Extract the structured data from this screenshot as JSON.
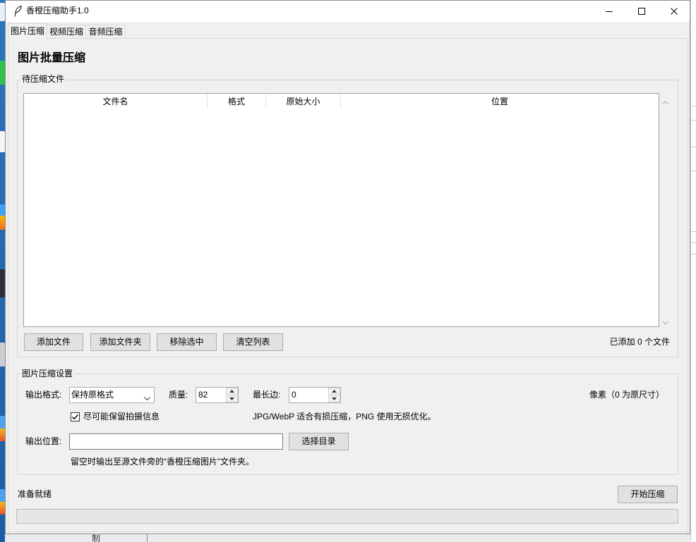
{
  "desktop": {
    "partial_label": "制"
  },
  "window": {
    "title": "香橙压缩助手1.0",
    "icon": "feather-icon",
    "controls": [
      "minimize-icon",
      "maximize-icon",
      "close-icon"
    ]
  },
  "tabs": [
    {
      "label": "图片压缩",
      "selected": true
    },
    {
      "label": "视频压缩",
      "selected": false
    },
    {
      "label": "音频压缩",
      "selected": false
    }
  ],
  "image_tab": {
    "heading": "图片批量压缩",
    "files": {
      "group_title": "待压缩文件",
      "columns": [
        "文件名",
        "格式",
        "原始大小",
        "位置"
      ],
      "rows": [],
      "scrollbar_icons": [
        "chevron-up-icon",
        "chevron-down-icon"
      ],
      "buttons": {
        "add_files": "添加文件",
        "add_folder": "添加文件夹",
        "remove_selected": "移除选中",
        "clear_list": "清空列表"
      },
      "count_text": "已添加 0 个文件"
    },
    "settings": {
      "group_title": "图片压缩设置",
      "format": {
        "label": "输出格式:",
        "value": "保持原格式",
        "icon": "chevron-down-icon"
      },
      "quality": {
        "label": "质量:",
        "value": "82"
      },
      "max_side": {
        "label": "最长边:",
        "value": "0",
        "unit": "像素（0 为原尺寸）"
      },
      "keep_exif": {
        "label": "尽可能保留拍摄信息",
        "checked": true
      },
      "format_hint": "JPG/WebP 适合有损压缩，PNG 使用无损优化。",
      "output": {
        "label": "输出位置:",
        "value": "",
        "browse_label": "选择目录",
        "hint": "留空时输出至源文件旁的“香橙压缩图片”文件夹。"
      }
    },
    "status": "准备就绪",
    "start_label": "开始压缩",
    "progress": 0
  },
  "colors": {
    "desktop": "#1d68b0",
    "window_bg": "#f0f0f0",
    "titlebar_bg": "#ffffff",
    "list_bg": "#ffffff",
    "button_bg": "#e1e1e1",
    "button_border": "#adadad"
  }
}
